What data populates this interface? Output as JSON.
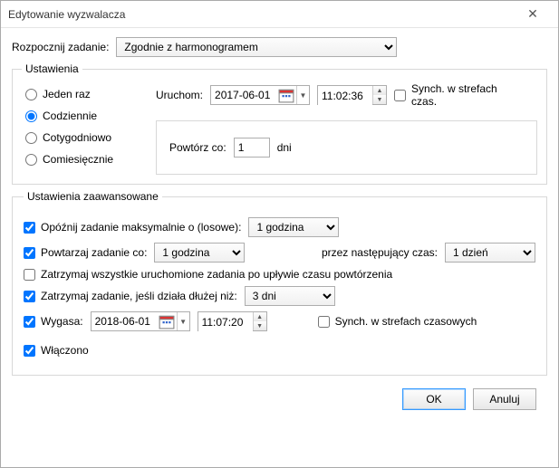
{
  "window": {
    "title": "Edytowanie wyzwalacza"
  },
  "begin": {
    "label": "Rozpocznij zadanie:",
    "value": "Zgodnie z harmonogramem"
  },
  "settings": {
    "legend": "Ustawienia",
    "radios": {
      "once": "Jeden raz",
      "daily": "Codziennie",
      "weekly": "Cotygodniowo",
      "monthly": "Comiesięcznie"
    },
    "start_label": "Uruchom:",
    "start_date": "2017-06-01",
    "start_time": "11:02:36",
    "sync_label": "Synch. w strefach czas.",
    "recur_label": "Powtórz co:",
    "recur_value": "1",
    "recur_unit": "dni"
  },
  "advanced": {
    "legend": "Ustawienia zaawansowane",
    "delay_label": "Opóźnij zadanie maksymalnie o (losowe):",
    "delay_value": "1 godzina",
    "repeat_label": "Powtarzaj zadanie co:",
    "repeat_value": "1 godzina",
    "duration_label": "przez następujący czas:",
    "duration_value": "1 dzień",
    "stop_all_label": "Zatrzymaj wszystkie uruchomione zadania po upływie czasu powtórzenia",
    "stop_if_label": "Zatrzymaj zadanie, jeśli działa dłużej niż:",
    "stop_if_value": "3 dni",
    "expire_label": "Wygasa:",
    "expire_date": "2018-06-01",
    "expire_time": "11:07:20",
    "expire_sync_label": "Synch. w strefach czasowych",
    "enabled_label": "Włączono"
  },
  "buttons": {
    "ok": "OK",
    "cancel": "Anuluj"
  }
}
